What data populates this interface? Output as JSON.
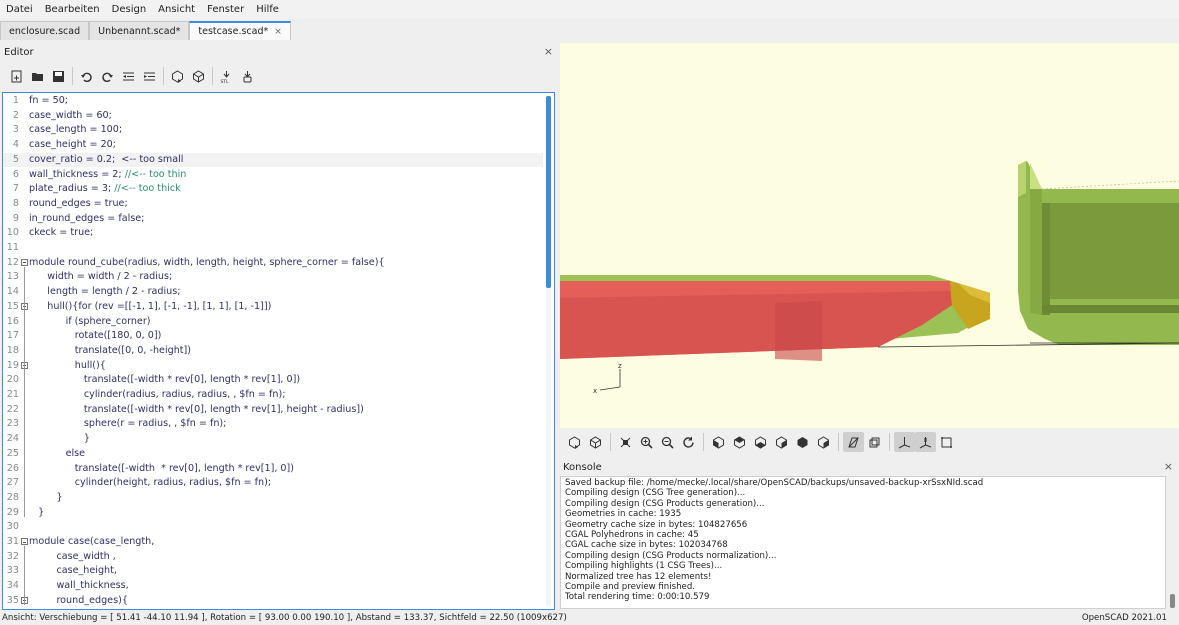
{
  "menubar": [
    "Datei",
    "Bearbeiten",
    "Design",
    "Ansicht",
    "Fenster",
    "Hilfe"
  ],
  "tabs": [
    {
      "label": "enclosure.scad",
      "active": false
    },
    {
      "label": "Unbenannt.scad*",
      "active": false
    },
    {
      "label": "testcase.scad*",
      "active": true,
      "close": "×"
    }
  ],
  "editor": {
    "title": "Editor",
    "close": "×",
    "toolbar_icons": [
      "new-file-icon",
      "open-file-icon",
      "save-icon",
      "undo-icon",
      "redo-icon",
      "unindent-icon",
      "indent-icon",
      "preview-icon",
      "render-icon",
      "export-stl-icon",
      "send-to-printer-icon"
    ],
    "lines": [
      {
        "n": "1",
        "text": "fn = 50;"
      },
      {
        "n": "2",
        "text": "case_width = 60;"
      },
      {
        "n": "3",
        "text": "case_length = 100;"
      },
      {
        "n": "4",
        "text": "case_height = 20;"
      },
      {
        "n": "5",
        "text": "cover_ratio = 0.2;  <-- too small",
        "current": true
      },
      {
        "n": "6",
        "text": "wall_thickness = 2; ",
        "comment": "//<-- too thin"
      },
      {
        "n": "7",
        "text": "plate_radius = 3; ",
        "comment": "//<-- too thick"
      },
      {
        "n": "8",
        "text": "round_edges = true;"
      },
      {
        "n": "9",
        "text": "in_round_edges = false;"
      },
      {
        "n": "10",
        "text": "ckeck = true;"
      },
      {
        "n": "11",
        "text": ""
      },
      {
        "n": "12",
        "text": "module round_cube(radius, width, length, height, sphere_corner = false){",
        "fold": true
      },
      {
        "n": "13",
        "text": "      width = width / 2 - radius;"
      },
      {
        "n": "14",
        "text": "      length = length / 2 - radius;"
      },
      {
        "n": "15",
        "text": "      hull(){for (rev =[[-1, 1], [-1, -1], [1, 1], [1, -1]])",
        "fold": true
      },
      {
        "n": "16",
        "text": "            if (sphere_corner)"
      },
      {
        "n": "17",
        "text": "               rotate([180, 0, 0])"
      },
      {
        "n": "18",
        "text": "               translate([0, 0, -height])"
      },
      {
        "n": "19",
        "text": "               hull(){",
        "fold": true
      },
      {
        "n": "20",
        "text": "                  translate([-width * rev[0], length * rev[1], 0])"
      },
      {
        "n": "21",
        "text": "                  cylinder(radius, radius, radius, , $fn = fn);"
      },
      {
        "n": "22",
        "text": "                  translate([-width * rev[0], length * rev[1], height - radius])"
      },
      {
        "n": "23",
        "text": "                  sphere(r = radius, , $fn = fn);"
      },
      {
        "n": "24",
        "text": "                  }"
      },
      {
        "n": "25",
        "text": "            else"
      },
      {
        "n": "26",
        "text": "               translate([-width  * rev[0], length * rev[1], 0])"
      },
      {
        "n": "27",
        "text": "               cylinder(height, radius, radius, $fn = fn);"
      },
      {
        "n": "28",
        "text": "         }"
      },
      {
        "n": "29",
        "text": "   }"
      },
      {
        "n": "30",
        "text": ""
      },
      {
        "n": "31",
        "text": "module case(case_length,",
        "fold": true
      },
      {
        "n": "32",
        "text": "         case_width ,"
      },
      {
        "n": "33",
        "text": "         case_height,"
      },
      {
        "n": "34",
        "text": "         wall_thickness,"
      },
      {
        "n": "35",
        "text": "         round_edges){",
        "fold": true
      }
    ]
  },
  "viewport": {
    "background": "#fdfde1",
    "axis_labels": {
      "z": "z",
      "x": "x"
    }
  },
  "viewbar_icons": [
    {
      "name": "preview-icon",
      "on": false
    },
    {
      "name": "render-icon",
      "on": false
    },
    {
      "sep": true
    },
    {
      "name": "view-all-icon",
      "on": false
    },
    {
      "name": "zoom-in-icon",
      "on": false
    },
    {
      "name": "zoom-out-icon",
      "on": false
    },
    {
      "name": "reset-view-icon",
      "on": false
    },
    {
      "sep": true
    },
    {
      "name": "view-right-icon",
      "on": false
    },
    {
      "name": "view-top-icon",
      "on": false
    },
    {
      "name": "view-bottom-icon",
      "on": false
    },
    {
      "name": "view-left-icon",
      "on": false
    },
    {
      "name": "view-front-icon",
      "on": false
    },
    {
      "name": "view-back-icon",
      "on": false
    },
    {
      "sep": true
    },
    {
      "name": "perspective-icon",
      "on": true
    },
    {
      "name": "orthogonal-icon",
      "on": false
    },
    {
      "sep": true
    },
    {
      "name": "show-axes-icon",
      "on": true
    },
    {
      "name": "show-scale-markers-icon",
      "on": true
    },
    {
      "name": "show-edges-icon",
      "on": false
    }
  ],
  "console": {
    "title": "Konsole",
    "close": "×",
    "lines": [
      "Saved backup file: /home/mecke/.local/share/OpenSCAD/backups/unsaved-backup-xrSsxNId.scad",
      "Compiling design (CSG Tree generation)...",
      "Compiling design (CSG Products generation)...",
      "Geometries in cache: 1935",
      "Geometry cache size in bytes: 104827656",
      "CGAL Polyhedrons in cache: 45",
      "CGAL cache size in bytes: 102034768",
      "Compiling design (CSG Products normalization)...",
      "Compiling highlights (1 CSG Trees)...",
      "Normalized tree has 12 elements!",
      "Compile and preview finished.",
      "Total rendering time: 0:00:10.579"
    ]
  },
  "status": {
    "left": "Ansicht: Verschiebung = [ 51.41 -44.10 11.94 ], Rotation = [ 93.00 0.00 190.10 ], Abstand = 133.37, Sichtfeld = 22.50 (1009x627)",
    "right": "OpenSCAD 2021.01"
  },
  "colors": {
    "accent": "#3b8be0",
    "model_green": "#9cc154",
    "model_red": "#e25d57",
    "model_gold": "#c8a51e"
  }
}
